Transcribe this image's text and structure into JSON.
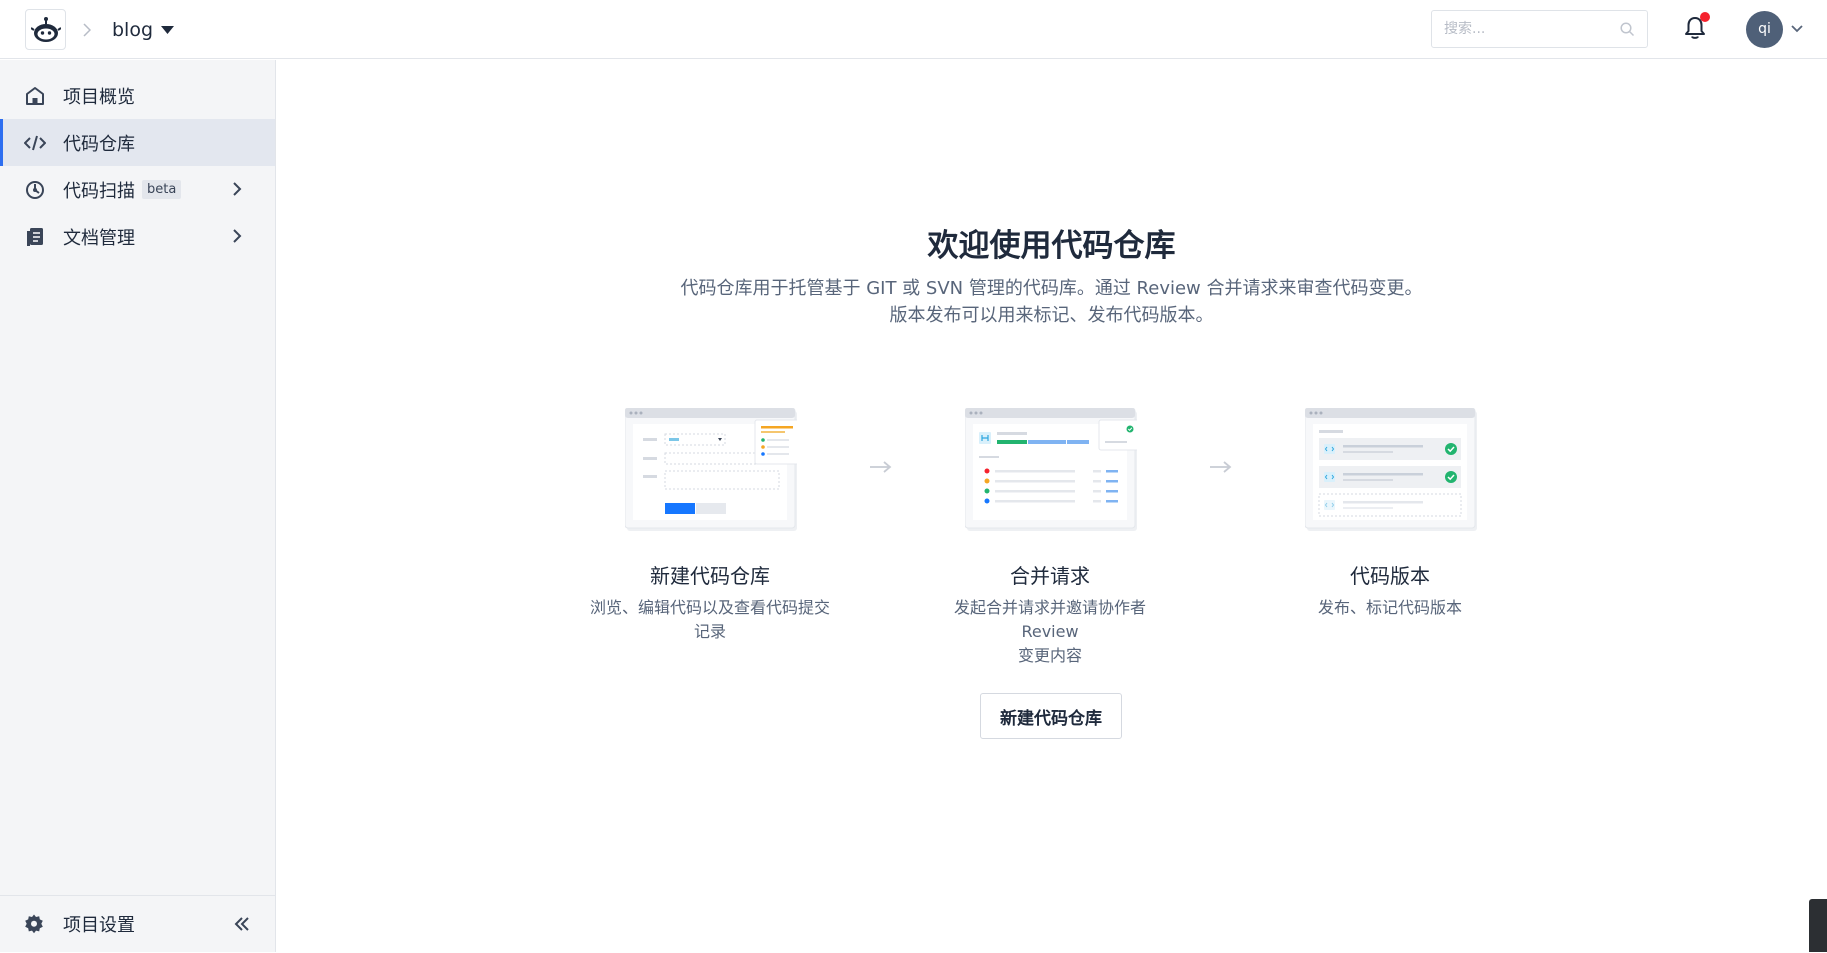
{
  "header": {
    "project_name": "blog",
    "search_placeholder": "搜索...",
    "user_initials": "qi",
    "has_notification": true
  },
  "sidebar": {
    "items": [
      {
        "label": "项目概览",
        "icon": "home-icon"
      },
      {
        "label": "代码仓库",
        "icon": "code-icon",
        "active": true
      },
      {
        "label": "代码扫描",
        "icon": "scan-icon",
        "badge": "beta",
        "expandable": true
      },
      {
        "label": "文档管理",
        "icon": "document-icon",
        "expandable": true
      }
    ],
    "settings_label": "项目设置"
  },
  "main": {
    "title": "欢迎使用代码仓库",
    "description_line1": "代码仓库用于托管基于 GIT 或 SVN 管理的代码库。通过 Review 合并请求来审查代码变更。",
    "description_line2": "版本发布可以用来标记、发布代码版本。",
    "steps": [
      {
        "title": "新建代码仓库",
        "desc_line1": "浏览、编辑代码以及查看代码提交",
        "desc_line2": "记录"
      },
      {
        "title": "合并请求",
        "desc_line1": "发起合并请求并邀请协作者 Review",
        "desc_line2": "变更内容"
      },
      {
        "title": "代码版本",
        "desc_line1": "发布、标记代码版本",
        "desc_line2": ""
      }
    ],
    "cta_label": "新建代码仓库"
  },
  "colors": {
    "accent": "#2d6ef0",
    "notification": "#f5222d",
    "avatar_bg": "#4f6078",
    "success": "#22b46f"
  }
}
